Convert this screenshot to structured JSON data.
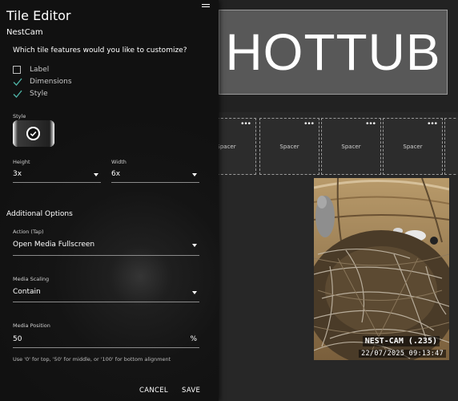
{
  "dashboard": {
    "banner_text": "HOTTUB",
    "spacers": [
      {
        "label": "Spacer",
        "menu": "•••"
      },
      {
        "label": "Spacer",
        "menu": "•••"
      },
      {
        "label": "Spacer",
        "menu": "•••"
      },
      {
        "label": "Spacer",
        "menu": "•••"
      }
    ],
    "camera": {
      "overlay_name": "NEST-CAM (.235)",
      "timestamp": "22/07/2025 09:13:47"
    }
  },
  "editor": {
    "title": "Tile Editor",
    "tile_name": "NestCam",
    "question": "Which tile features would you like to customize?",
    "features": [
      {
        "label": "Label",
        "checked": false
      },
      {
        "label": "Dimensions",
        "checked": true
      },
      {
        "label": "Style",
        "checked": true
      }
    ],
    "style_label": "Style",
    "height": {
      "label": "Height",
      "value": "3x"
    },
    "width": {
      "label": "Width",
      "value": "6x"
    },
    "additional_options_title": "Additional Options",
    "action": {
      "label": "Action (Tap)",
      "value": "Open Media Fullscreen"
    },
    "media_scaling": {
      "label": "Media Scaling",
      "value": "Contain"
    },
    "media_position": {
      "label": "Media Position",
      "value": "50",
      "unit": "%"
    },
    "helper_text": "Use '0' for top, '50' for middle, or '100' for bottom alignment",
    "cancel_label": "CANCEL",
    "save_label": "SAVE"
  },
  "colors": {
    "panel_bg": "#141414",
    "check_accent": "#4fb6a8",
    "dashboard_bg": "#272727"
  }
}
